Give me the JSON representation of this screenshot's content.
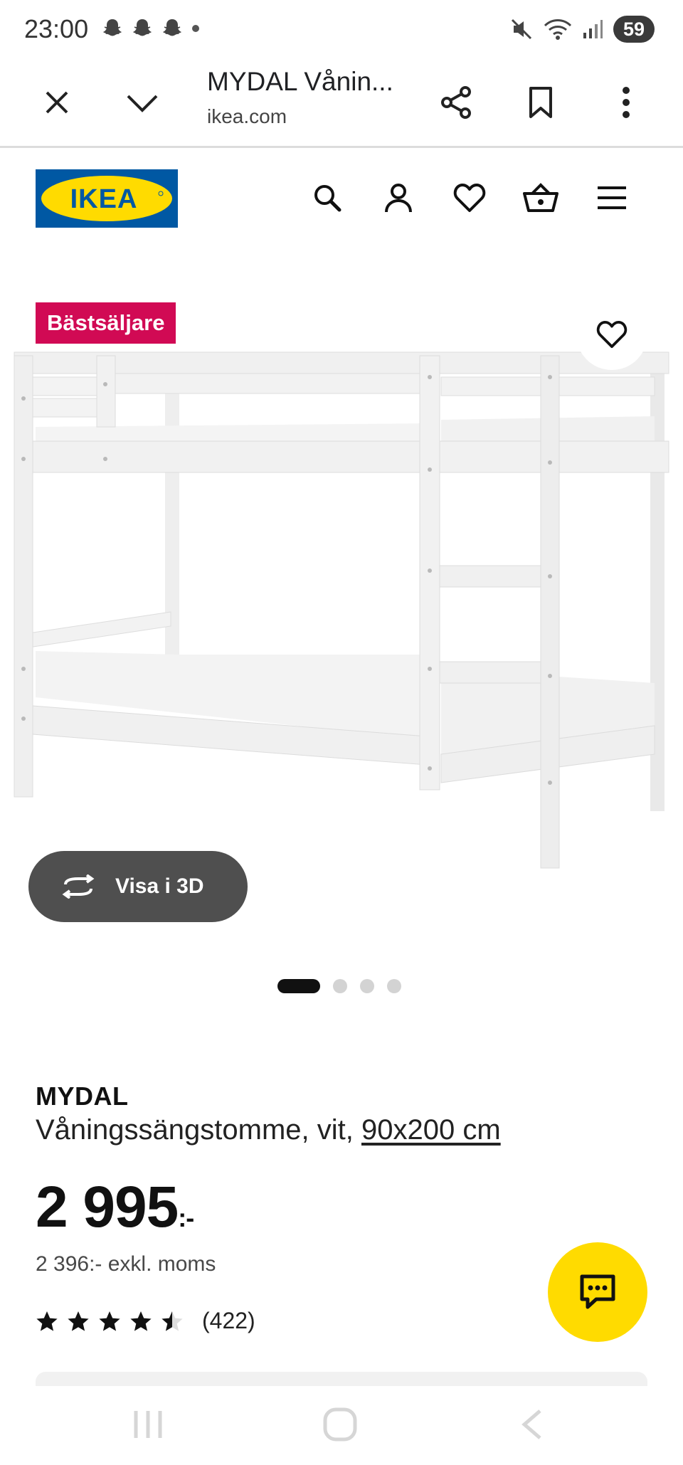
{
  "status_bar": {
    "time": "23:00",
    "notification_icons": [
      "snapchat-icon",
      "snapchat-icon",
      "snapchat-icon",
      "dot-icon"
    ],
    "battery": "59"
  },
  "browser": {
    "page_title": "MYDAL Vånin...",
    "domain": "ikea.com"
  },
  "header": {
    "logo_text": "IKEA",
    "icons": [
      "search-icon",
      "account-icon",
      "heart-icon",
      "basket-icon",
      "menu-icon"
    ]
  },
  "gallery": {
    "badge": "Bästsäljare",
    "view_3d_label": "Visa i 3D",
    "image_count": 4,
    "active_image": 1
  },
  "product": {
    "name": "MYDAL",
    "description": "Våningssängstomme, vit, ",
    "size": "90x200 cm",
    "price": "2 995",
    "price_suffix": ":-",
    "price_ex_vat": "2 396:- exkl. moms",
    "rating": 4.5,
    "rating_max": 5,
    "review_count": "(422)"
  },
  "colors": {
    "ikea_blue": "#0058a3",
    "ikea_yellow": "#ffdb00",
    "badge_red": "#d10a54"
  }
}
